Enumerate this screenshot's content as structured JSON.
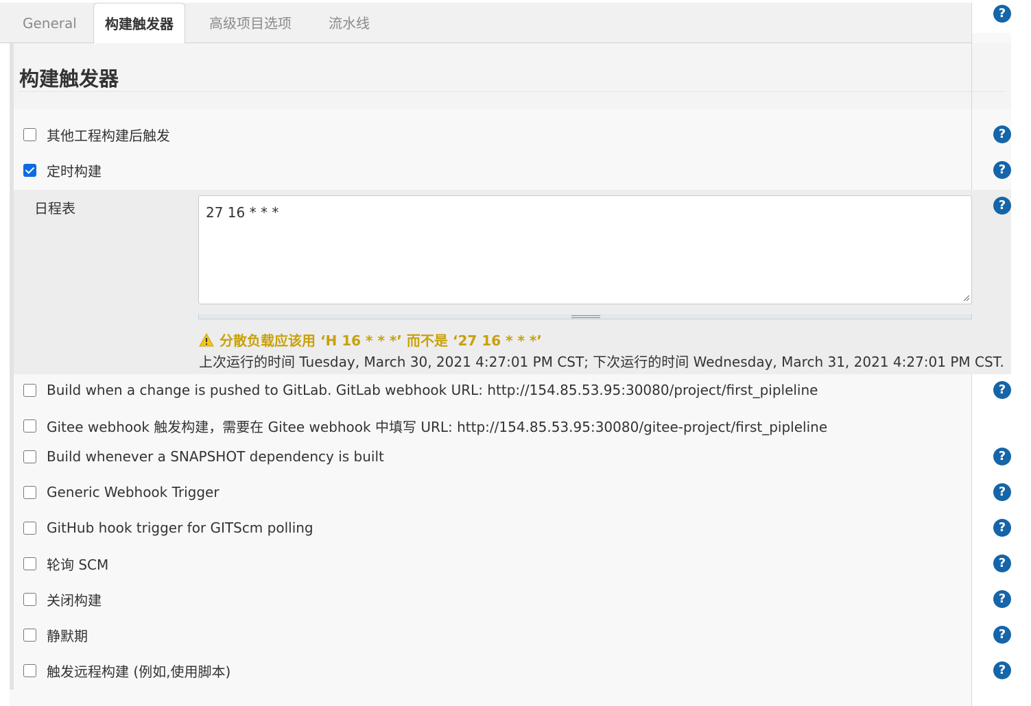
{
  "tabs": [
    {
      "label": "General",
      "active": false
    },
    {
      "label": "构建触发器",
      "active": true
    },
    {
      "label": "高级项目选项",
      "active": false
    },
    {
      "label": "流水线",
      "active": false
    }
  ],
  "section": {
    "title": "构建触发器"
  },
  "triggers": [
    {
      "label": "其他工程构建后触发",
      "checked": false,
      "help": true
    },
    {
      "label": "定时构建",
      "checked": true,
      "help": true
    },
    {
      "label": "Build when a change is pushed to GitLab. GitLab webhook URL: http://154.85.53.95:30080/project/first_pipleline",
      "checked": false,
      "help": true
    },
    {
      "label": "Gitee webhook 触发构建，需要在 Gitee webhook 中填写 URL: http://154.85.53.95:30080/gitee-project/first_pipleline",
      "checked": false,
      "help": false
    },
    {
      "label": "Build whenever a SNAPSHOT dependency is built",
      "checked": false,
      "help": true
    },
    {
      "label": "Generic Webhook Trigger",
      "checked": false,
      "help": true
    },
    {
      "label": "GitHub hook trigger for GITScm polling",
      "checked": false,
      "help": true
    },
    {
      "label": "轮询 SCM",
      "checked": false,
      "help": true
    },
    {
      "label": "关闭构建",
      "checked": false,
      "help": true
    },
    {
      "label": "静默期",
      "checked": false,
      "help": true
    },
    {
      "label": "触发远程构建 (例如,使用脚本)",
      "checked": false,
      "help": true
    }
  ],
  "schedule": {
    "label": "日程表",
    "value": "27 16 * * *",
    "warning": "分散负载应该用 ‘H 16 * * *’ 而不是 ‘27 16 * * *’",
    "info": "上次运行的时间 Tuesday, March 30, 2021 4:27:01 PM CST; 下次运行的时间 Wednesday, March 31, 2021 4:27:01 PM CST."
  },
  "help_icon_glyph": "?",
  "colors": {
    "accent": "#0b6ce3",
    "help": "#1565a8",
    "warning": "#c8a10a"
  }
}
